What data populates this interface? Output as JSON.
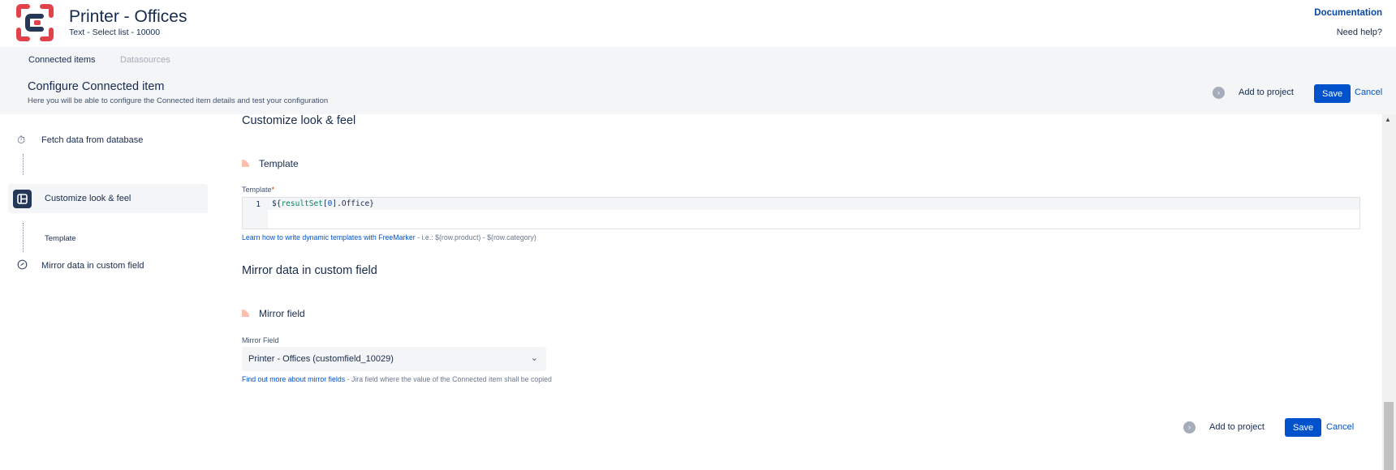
{
  "header": {
    "title": "Printer - Offices",
    "subtitle": "Text - Select list - 10000",
    "documentation_link": "Documentation",
    "help_link": "Need help?"
  },
  "tabs": [
    {
      "label": "Connected items",
      "state": "active"
    },
    {
      "label": "Datasources",
      "state": "disabled"
    }
  ],
  "config": {
    "title": "Configure Connected item",
    "subtitle": "Here you will be able to configure the Connected item details and test your configuration"
  },
  "actions": {
    "add_to_project": "Add to project",
    "save": "Save",
    "cancel": "Cancel"
  },
  "sidebar": {
    "steps": [
      {
        "label": "Fetch data from database",
        "icon": "stopwatch-icon"
      },
      {
        "label": "Customize look & feel",
        "icon": "layout-icon",
        "active": true
      },
      {
        "label": "Mirror data in custom field",
        "icon": "check-circle-icon"
      }
    ],
    "substep": "Template"
  },
  "customize": {
    "title": "Customize look & feel",
    "subsection": "Template",
    "field_label": "Template",
    "required_mark": "*",
    "line_number": "1",
    "code": {
      "open": "${",
      "var": "resultSet",
      "lb": "[",
      "index": "0",
      "rest": "].Office}"
    },
    "help_link": "Learn how to write dynamic templates with FreeMarker",
    "help_text": " - i.e.: $(row.product) - $(row.category)"
  },
  "mirror": {
    "title": "Mirror data in custom field",
    "subsection": "Mirror field",
    "field_label": "Mirror Field",
    "selected_value": "Printer - Offices (customfield_10029)",
    "help_link": "Find out more about mirror fields",
    "help_text": " - Jira field where the value of the Connected item shall be copied"
  },
  "colors": {
    "primary": "#0052cc",
    "brand_red": "#e2424b",
    "brand_dark": "#253858",
    "accent_pill": "#ffbdad"
  }
}
